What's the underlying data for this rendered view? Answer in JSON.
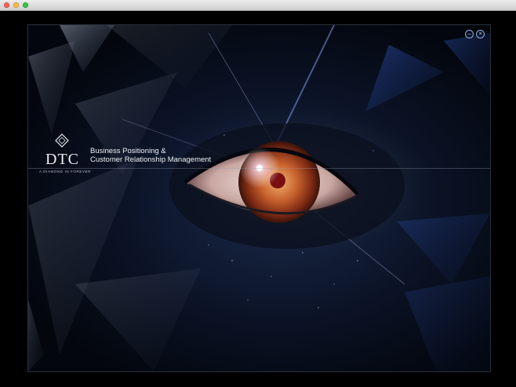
{
  "window": {
    "controls": [
      "close",
      "minimize",
      "zoom"
    ]
  },
  "brand": {
    "logo_text": "DTC",
    "tagline": "A DIAMOND IN FOREVER",
    "headline_line1": "Business Positioning &",
    "headline_line2": "Customer Relationship Management",
    "logo_icon": "diamond-outline-icon"
  },
  "stage_controls": {
    "minimize_glyph": "–",
    "close_glyph": "×"
  },
  "colors": {
    "background": "#000000",
    "stage_blue": "#0b1326",
    "iris": "#c0552e",
    "accent": "#8fb0d8"
  }
}
